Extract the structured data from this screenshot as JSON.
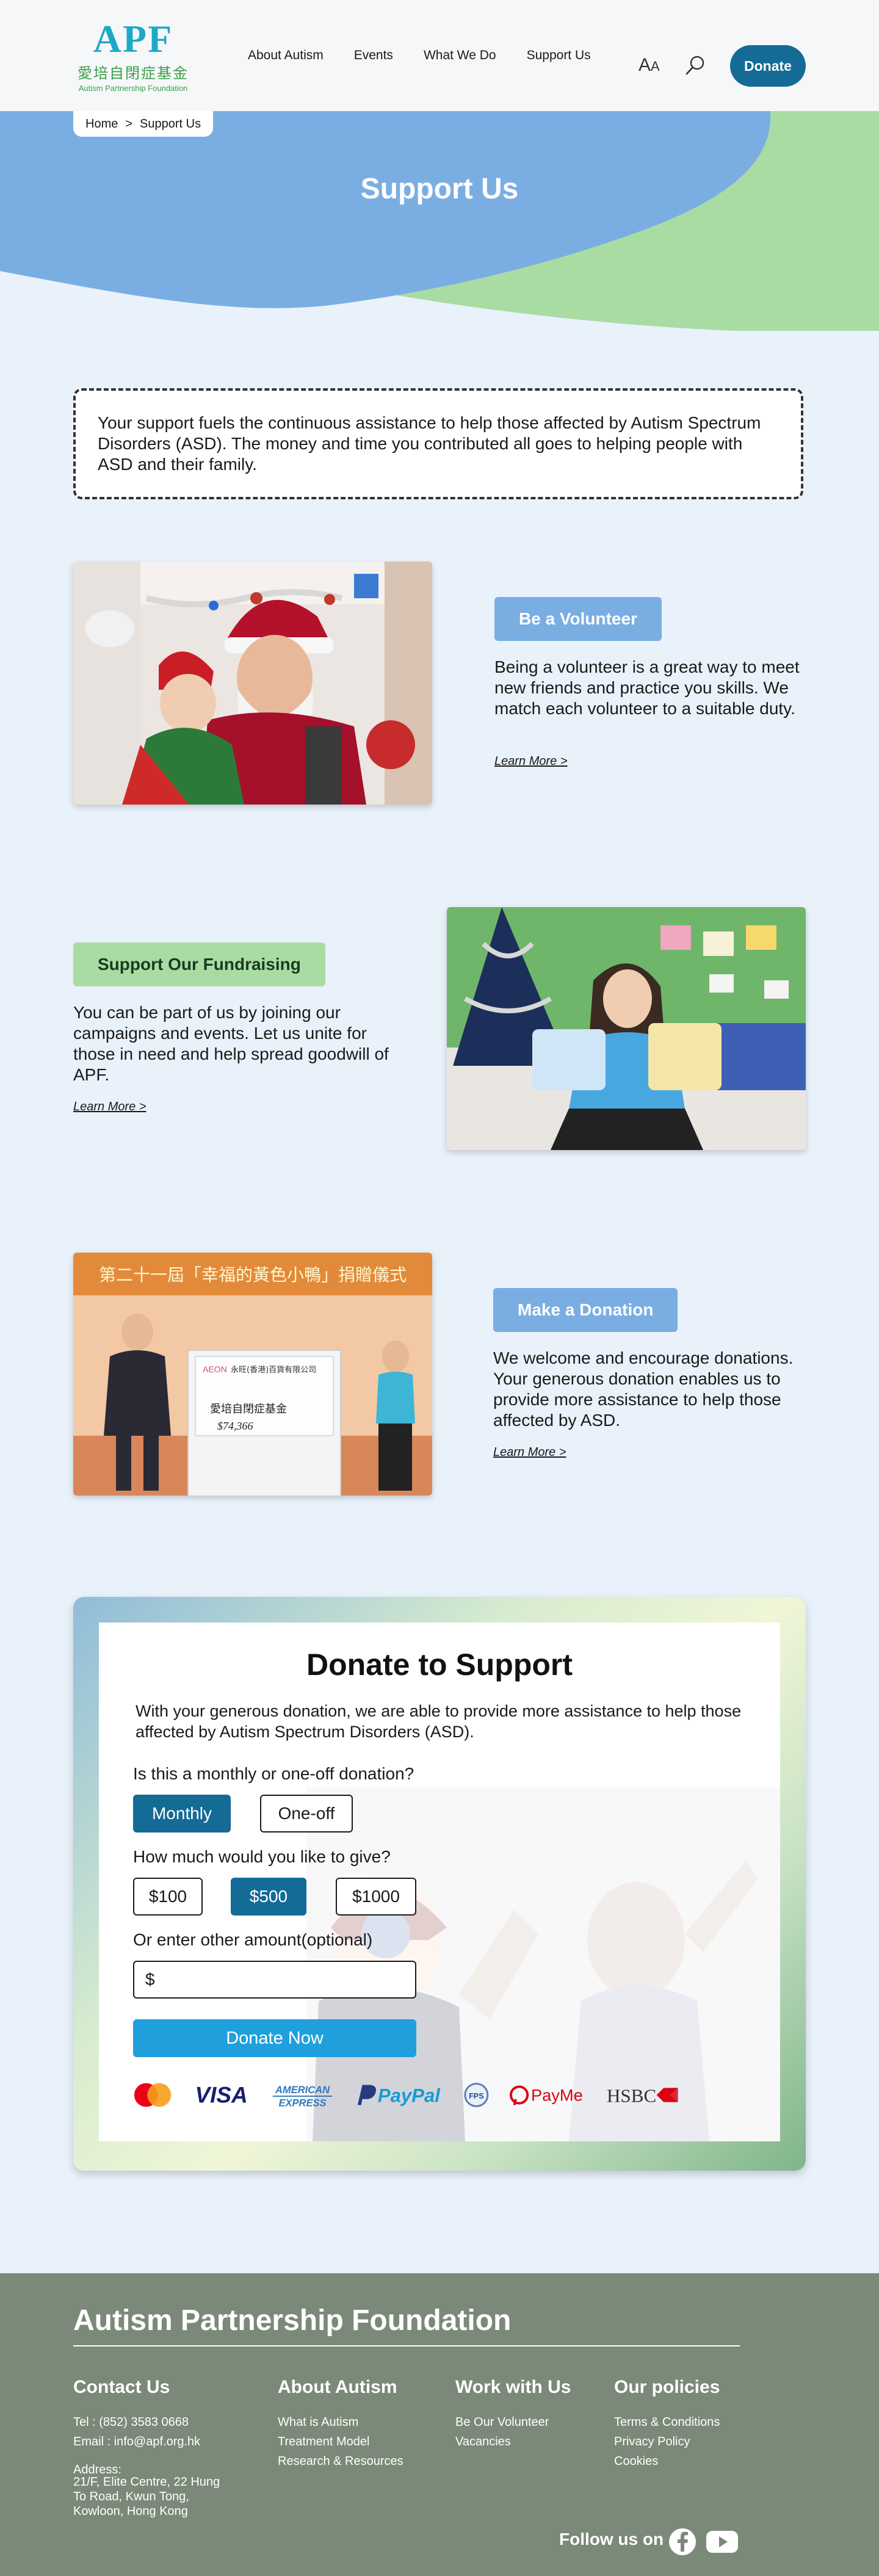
{
  "header": {
    "logo_mark": "APF",
    "logo_cn": "愛培自閉症基金",
    "logo_en": "Autism Partnership Foundation",
    "nav": [
      "About Autism",
      "Events",
      "What We Do",
      "Support Us"
    ],
    "font_size_label": "A",
    "font_size_label_small": "A",
    "donate": "Donate"
  },
  "breadcrumb": {
    "home": "Home",
    "separator": ">",
    "current": "Support Us"
  },
  "hero": {
    "title": "Support Us"
  },
  "intro": {
    "text": "Your support fuels the continuous assistance to help those affected by Autism Spectrum Disorders (ASD). The money and time you contributed all goes to helping people with ASD and their family."
  },
  "sections": [
    {
      "button": "Be a Volunteer",
      "text": "Being a volunteer is a great way to meet new friends and practice you skills. We match each volunteer to a suitable duty.",
      "link": "Learn More >"
    },
    {
      "button": "Support Our Fundraising",
      "text": "You can be part of us by joining our campaigns and events. Let us unite for those in need and help spread goodwill of APF.",
      "link": "Learn More >"
    },
    {
      "button": "Make a Donation",
      "text": "We welcome and encourage donations. Your generous donation enables us to provide more assistance to help those affected by ASD.",
      "link": "Learn More >"
    }
  ],
  "photo3": {
    "banner": "第二十一屆「幸福的黃色小鴨」捐贈儀式",
    "cheque_company": "永旺(香港)百貨有限公司",
    "cheque_brand": "AEON",
    "cheque_payee": "愛培自閉症基金",
    "cheque_amount": "$74,366"
  },
  "donate": {
    "title": "Donate to Support",
    "desc": "With your generous donation, we are able to provide more assistance to help those affected by Autism Spectrum Disorders (ASD).",
    "q_frequency": "Is this a monthly or one-off donation?",
    "frequency": [
      {
        "label": "Monthly",
        "selected": true
      },
      {
        "label": "One-off",
        "selected": false
      }
    ],
    "q_amount": "How much would you like to give?",
    "amounts": [
      {
        "label": "$100",
        "selected": false
      },
      {
        "label": "$500",
        "selected": true
      },
      {
        "label": "$1000",
        "selected": false
      }
    ],
    "q_other": "Or enter other amount(optional)",
    "currency_prefix": "$",
    "submit": "Donate Now",
    "payment_methods": [
      "mastercard-icon",
      "visa-icon",
      "american-express-icon",
      "paypal-icon",
      "fps-icon",
      "payme-icon",
      "hsbc-icon"
    ],
    "payment_labels": {
      "visa": "VISA",
      "amex_1": "AMERICAN",
      "amex_2": "EXPRESS",
      "paypal": "PayPal",
      "fps": "FPS",
      "payme": "PayMe",
      "hsbc": "HSBC"
    }
  },
  "footer": {
    "title": "Autism Partnership Foundation",
    "contact": {
      "heading": "Contact Us",
      "tel": "Tel : (852) 3583 0668",
      "email": "Email : info@apf.org.hk",
      "address_label": "Address:",
      "address": [
        "21/F, Elite Centre, 22 Hung",
        "To Road, Kwun Tong,",
        "Kowloon, Hong Kong"
      ]
    },
    "about": {
      "heading": "About Autism",
      "links": [
        "What is Autism",
        "Treatment Model",
        "Research & Resources"
      ]
    },
    "work": {
      "heading": "Work with Us",
      "links": [
        "Be Our Volunteer",
        "Vacancies"
      ]
    },
    "policies": {
      "heading": "Our policies",
      "links": [
        "Terms & Conditions",
        "Privacy Policy",
        "Cookies"
      ]
    },
    "follow": "Follow us on",
    "social": [
      "facebook-icon",
      "youtube-icon"
    ]
  },
  "colors": {
    "primary": "#136b96",
    "hero_blue": "#7aaee3",
    "hero_green": "#a9dca3",
    "page_bg": "#e9f1fb",
    "footer_bg": "#7b8a78",
    "donate_now": "#1fa0dd"
  }
}
